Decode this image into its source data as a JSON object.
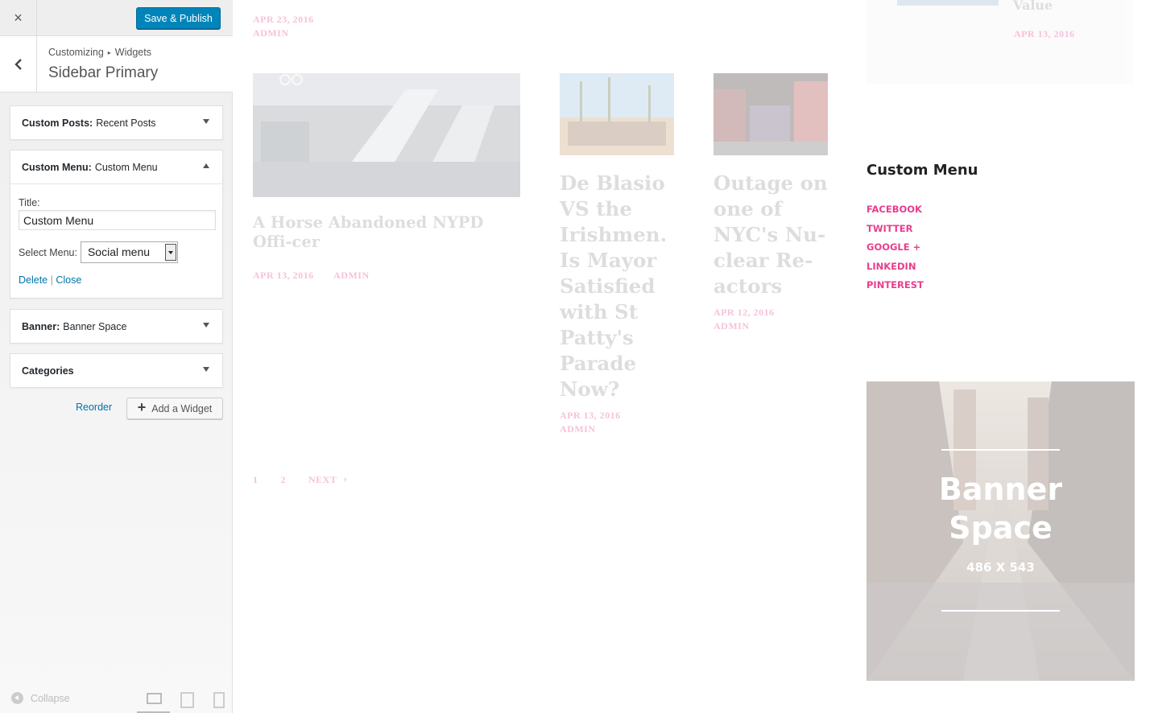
{
  "customizer": {
    "close_icon": "×",
    "publish_label": "Save & Publish",
    "breadcrumb": {
      "part1": "Customizing",
      "separator": "▸",
      "part2": "Widgets"
    },
    "panel_title": "Sidebar Primary",
    "widgets": [
      {
        "type": "Custom Posts:",
        "name": "Recent Posts"
      },
      {
        "type": "Custom Menu:",
        "name": "Custom Menu"
      },
      {
        "type": "Banner:",
        "name": "Banner Space"
      },
      {
        "type": "Categories",
        "name": ""
      }
    ],
    "form": {
      "title_label": "Title:",
      "title_value": "Custom Menu",
      "select_label": "Select Menu:",
      "select_value": "Social menu",
      "delete_label": "Delete",
      "separator": "|",
      "close_label": "Close"
    },
    "reorder_label": "Reorder",
    "add_widget_label": "Add a Widget",
    "collapse_label": "Collapse"
  },
  "preview": {
    "top_meta": {
      "date": "APR 23, 2016",
      "author": "ADMIN"
    },
    "top_right": {
      "title": "Value",
      "date": "APR 13, 2016"
    },
    "posts": [
      {
        "title": "A Horse Abandoned NYPD Offi-cer",
        "date": "APR 13, 2016",
        "author": "ADMIN"
      },
      {
        "title": "De Blasio VS the Irishmen. Is Mayor Satisfied with St Patty's Parade Now?",
        "date": "APR 13, 2016",
        "author": "ADMIN"
      },
      {
        "title": "Outage on one of NYC's Nu-clear Re-actors",
        "date": "APR 12, 2016",
        "author": "ADMIN"
      }
    ],
    "pagination": {
      "page1": "1",
      "page2": "2",
      "next": "NEXT",
      "next_arrow": "›"
    },
    "custom_menu": {
      "heading": "Custom Menu",
      "items": [
        "FACEBOOK",
        "TWITTER",
        "GOOGLE +",
        "LINKEDIN",
        "PINTEREST"
      ]
    },
    "banner": {
      "line1": "Banner",
      "line2": "Space",
      "size": "486 X 543"
    }
  },
  "colors": {
    "accent": "#e83e8c",
    "publish": "#0085ba",
    "link": "#0073aa"
  }
}
